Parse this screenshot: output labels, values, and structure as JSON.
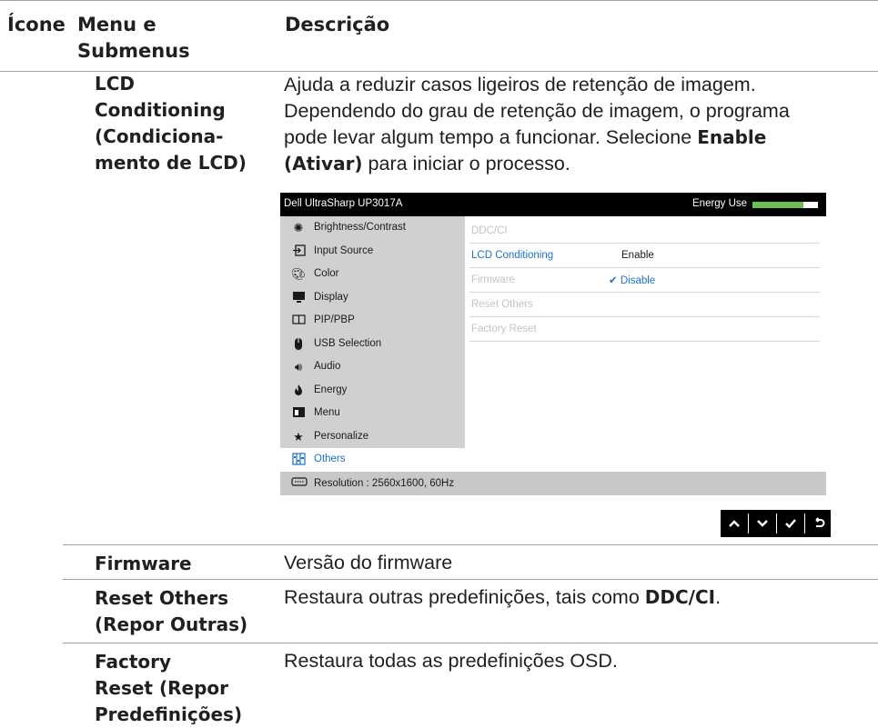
{
  "header": {
    "col1": "Ícone",
    "col2a": "Menu e",
    "col2b": "Submenus",
    "col3": "Descrição"
  },
  "rows": {
    "lcd": {
      "name": [
        "LCD",
        "Conditioning",
        "(Condiciona-",
        "mento de LCD)"
      ],
      "desc_l1": "Ajuda a reduzir casos ligeiros de retenção de imagem.",
      "desc_l2": "Dependendo do grau de retenção de imagem, o programa",
      "desc_l3a": "pode levar algum tempo a funcionar. Selecione ",
      "desc_l3b": "Enable",
      "desc_l4a": "(Ativar)",
      "desc_l4b": " para iniciar o processo."
    },
    "firmware": {
      "name": "Firmware",
      "desc": "Versão do firmware"
    },
    "reset_others": {
      "name": [
        "Reset Others",
        "(Repor Outras)"
      ],
      "desc_a": "Restaura outras predefinições, tais como ",
      "desc_b": "DDC/CI",
      "desc_c": "."
    },
    "factory": {
      "name": [
        "Factory",
        "Reset (Repor",
        "Predefinições)"
      ],
      "desc": "Restaura todas as predefinições OSD."
    }
  },
  "osd": {
    "title": "Dell UltraSharp UP3017A",
    "energy_label": "Energy Use",
    "energy_level": 0.78,
    "menu": [
      {
        "label": "Brightness/Contrast",
        "icon": "sun-icon"
      },
      {
        "label": "Input Source",
        "icon": "input-source-icon"
      },
      {
        "label": "Color",
        "icon": "color-icon"
      },
      {
        "label": "Display",
        "icon": "display-icon"
      },
      {
        "label": "PIP/PBP",
        "icon": "pip-icon"
      },
      {
        "label": "USB Selection",
        "icon": "usb-mouse-icon"
      },
      {
        "label": "Audio",
        "icon": "speaker-icon"
      },
      {
        "label": "Energy",
        "icon": "flame-icon"
      },
      {
        "label": "Menu",
        "icon": "menu-icon"
      },
      {
        "label": "Personalize",
        "icon": "star-icon"
      },
      {
        "label": "Others",
        "icon": "others-icon"
      }
    ],
    "submenu": [
      {
        "label": "DDC/CI"
      },
      {
        "label": "LCD Conditioning",
        "value": "Enable"
      },
      {
        "label": "Firmware",
        "value": "Disable"
      },
      {
        "label": "Reset Others"
      },
      {
        "label": "Factory Reset"
      }
    ],
    "resolution": "Resolution : 2560x1600, 60Hz",
    "accent_color": "#1a73c9"
  },
  "nav_buttons": [
    "up-icon",
    "down-icon",
    "check-icon",
    "back-icon"
  ]
}
